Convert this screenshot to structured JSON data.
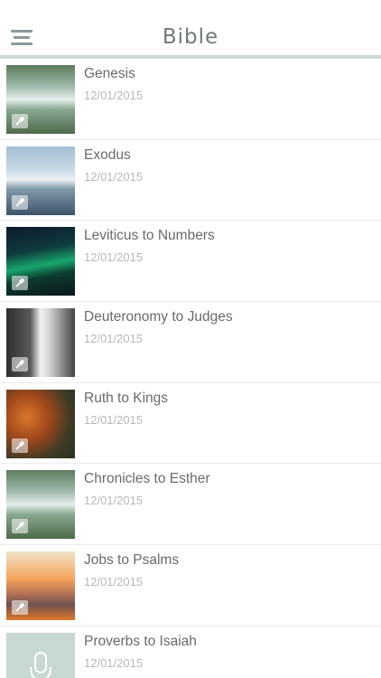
{
  "header": {
    "title": "Bible"
  },
  "items": [
    {
      "title": "Genesis",
      "date": "12/01/2015"
    },
    {
      "title": "Exodus",
      "date": "12/01/2015"
    },
    {
      "title": "Leviticus to Numbers",
      "date": "12/01/2015"
    },
    {
      "title": "Deuteronomy to Judges",
      "date": "12/01/2015"
    },
    {
      "title": "Ruth to Kings",
      "date": "12/01/2015"
    },
    {
      "title": "Chronicles to Esther",
      "date": "12/01/2015"
    },
    {
      "title": "Jobs to Psalms",
      "date": "12/01/2015"
    },
    {
      "title": "Proverbs to Isaiah",
      "date": "12/01/2015"
    }
  ],
  "icons": {
    "menu": "hamburger-menu-icon",
    "badge": "microphone-icon",
    "placeholder": "microphone-icon"
  },
  "colors": {
    "header_border": "#cfd9d5",
    "title": "#6f7b7a",
    "item_title": "#6a6a6a",
    "item_date": "#b8b8b8"
  }
}
